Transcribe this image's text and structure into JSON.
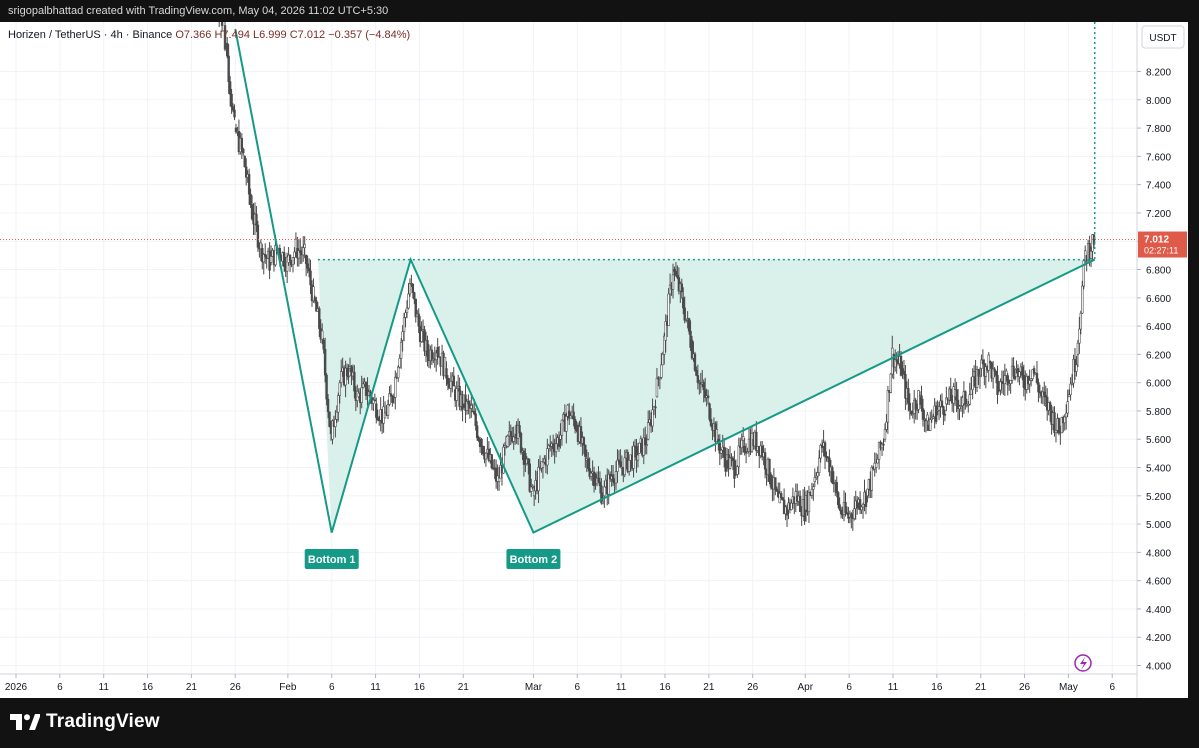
{
  "header": {
    "attribution": "srigopalbhattad created with TradingView.com, May 04, 2026 11:02 UTC+5:30"
  },
  "brand": {
    "name": "TradingView",
    "logo_icon": "tradingview-logo-icon"
  },
  "colors": {
    "accent": "#149a86",
    "fill": "#d4eee8",
    "price_line": "#e05a4a",
    "candle": "#4a4a4a"
  },
  "chart_data": {
    "type": "candlestick",
    "legend": {
      "symbol": "Horizen / TetherUS · 4h · Binance",
      "open": "O7.366",
      "high": "H7.494",
      "low": "L6.999",
      "close": "C7.012",
      "change": "−0.357 (−4.84%)"
    },
    "currency": "USDT",
    "ylim": [
      3.94,
      8.55
    ],
    "y_ticks": [
      "8.200",
      "8.000",
      "7.800",
      "7.600",
      "7.400",
      "7.200",
      "7.000",
      "6.800",
      "6.600",
      "6.400",
      "6.200",
      "6.000",
      "5.800",
      "5.600",
      "5.400",
      "5.200",
      "5.000",
      "4.800",
      "4.600",
      "4.400",
      "4.200",
      "4.000"
    ],
    "x_ticks": [
      {
        "label": "2026",
        "date": "2026-01-01"
      },
      {
        "label": "6",
        "date": "2026-01-06"
      },
      {
        "label": "11",
        "date": "2026-01-11"
      },
      {
        "label": "16",
        "date": "2026-01-16"
      },
      {
        "label": "21",
        "date": "2026-01-21"
      },
      {
        "label": "26",
        "date": "2026-01-26"
      },
      {
        "label": "Feb",
        "date": "2026-02-01"
      },
      {
        "label": "6",
        "date": "2026-02-06"
      },
      {
        "label": "11",
        "date": "2026-02-11"
      },
      {
        "label": "16",
        "date": "2026-02-16"
      },
      {
        "label": "21",
        "date": "2026-02-21"
      },
      {
        "label": "Mar",
        "date": "2026-03-01"
      },
      {
        "label": "6",
        "date": "2026-03-06"
      },
      {
        "label": "11",
        "date": "2026-03-11"
      },
      {
        "label": "16",
        "date": "2026-03-16"
      },
      {
        "label": "21",
        "date": "2026-03-21"
      },
      {
        "label": "26",
        "date": "2026-03-26"
      },
      {
        "label": "Apr",
        "date": "2026-04-01"
      },
      {
        "label": "6",
        "date": "2026-04-06"
      },
      {
        "label": "11",
        "date": "2026-04-11"
      },
      {
        "label": "16",
        "date": "2026-04-16"
      },
      {
        "label": "21",
        "date": "2026-04-21"
      },
      {
        "label": "26",
        "date": "2026-04-26"
      },
      {
        "label": "May",
        "date": "2026-05-01"
      },
      {
        "label": "6",
        "date": "2026-05-06"
      }
    ],
    "current_price": {
      "label": "7.012",
      "value": 7.012,
      "countdown": "02:27:11"
    },
    "price_path": [
      {
        "date": "2026-01-23",
        "price": 9.0
      },
      {
        "date": "2026-01-25",
        "price": 8.4
      },
      {
        "date": "2026-01-26",
        "price": 7.8
      },
      {
        "date": "2026-01-27",
        "price": 7.6
      },
      {
        "date": "2026-01-28",
        "price": 7.2
      },
      {
        "date": "2026-01-29",
        "price": 6.95
      },
      {
        "date": "2026-01-30",
        "price": 6.85
      },
      {
        "date": "2026-01-31",
        "price": 6.95
      },
      {
        "date": "2026-02-01",
        "price": 6.85
      },
      {
        "date": "2026-02-02",
        "price": 6.95
      },
      {
        "date": "2026-02-03",
        "price": 6.9
      },
      {
        "date": "2026-02-04",
        "price": 6.6
      },
      {
        "date": "2026-02-05",
        "price": 6.3
      },
      {
        "date": "2026-02-06",
        "price": 5.6
      },
      {
        "date": "2026-02-07",
        "price": 6.0
      },
      {
        "date": "2026-02-08",
        "price": 6.1
      },
      {
        "date": "2026-02-09",
        "price": 5.9
      },
      {
        "date": "2026-02-10",
        "price": 5.95
      },
      {
        "date": "2026-02-11",
        "price": 5.85
      },
      {
        "date": "2026-02-12",
        "price": 5.75
      },
      {
        "date": "2026-02-13",
        "price": 5.9
      },
      {
        "date": "2026-02-14",
        "price": 6.3
      },
      {
        "date": "2026-02-15",
        "price": 6.7
      },
      {
        "date": "2026-02-16",
        "price": 6.4
      },
      {
        "date": "2026-02-17",
        "price": 6.2
      },
      {
        "date": "2026-02-18",
        "price": 6.25
      },
      {
        "date": "2026-02-19",
        "price": 6.1
      },
      {
        "date": "2026-02-20",
        "price": 5.95
      },
      {
        "date": "2026-02-21",
        "price": 5.85
      },
      {
        "date": "2026-02-22",
        "price": 5.8
      },
      {
        "date": "2026-02-23",
        "price": 5.6
      },
      {
        "date": "2026-02-24",
        "price": 5.45
      },
      {
        "date": "2026-02-25",
        "price": 5.3
      },
      {
        "date": "2026-02-26",
        "price": 5.55
      },
      {
        "date": "2026-02-27",
        "price": 5.7
      },
      {
        "date": "2026-02-28",
        "price": 5.5
      },
      {
        "date": "2026-03-01",
        "price": 5.2
      },
      {
        "date": "2026-03-02",
        "price": 5.4
      },
      {
        "date": "2026-03-03",
        "price": 5.55
      },
      {
        "date": "2026-03-04",
        "price": 5.6
      },
      {
        "date": "2026-03-05",
        "price": 5.8
      },
      {
        "date": "2026-03-06",
        "price": 5.7
      },
      {
        "date": "2026-03-07",
        "price": 5.45
      },
      {
        "date": "2026-03-08",
        "price": 5.35
      },
      {
        "date": "2026-03-09",
        "price": 5.2
      },
      {
        "date": "2026-03-10",
        "price": 5.35
      },
      {
        "date": "2026-03-11",
        "price": 5.4
      },
      {
        "date": "2026-03-12",
        "price": 5.45
      },
      {
        "date": "2026-03-13",
        "price": 5.5
      },
      {
        "date": "2026-03-14",
        "price": 5.6
      },
      {
        "date": "2026-03-15",
        "price": 5.9
      },
      {
        "date": "2026-03-16",
        "price": 6.3
      },
      {
        "date": "2026-03-17",
        "price": 6.8
      },
      {
        "date": "2026-03-18",
        "price": 6.6
      },
      {
        "date": "2026-03-19",
        "price": 6.3
      },
      {
        "date": "2026-03-20",
        "price": 6.0
      },
      {
        "date": "2026-03-21",
        "price": 5.85
      },
      {
        "date": "2026-03-22",
        "price": 5.6
      },
      {
        "date": "2026-03-23",
        "price": 5.45
      },
      {
        "date": "2026-03-24",
        "price": 5.4
      },
      {
        "date": "2026-03-25",
        "price": 5.55
      },
      {
        "date": "2026-03-26",
        "price": 5.6
      },
      {
        "date": "2026-03-27",
        "price": 5.55
      },
      {
        "date": "2026-03-28",
        "price": 5.35
      },
      {
        "date": "2026-03-29",
        "price": 5.15
      },
      {
        "date": "2026-03-30",
        "price": 5.1
      },
      {
        "date": "2026-03-31",
        "price": 5.2
      },
      {
        "date": "2026-04-01",
        "price": 5.1
      },
      {
        "date": "2026-04-02",
        "price": 5.3
      },
      {
        "date": "2026-04-03",
        "price": 5.55
      },
      {
        "date": "2026-04-04",
        "price": 5.4
      },
      {
        "date": "2026-04-05",
        "price": 5.1
      },
      {
        "date": "2026-04-06",
        "price": 5.05
      },
      {
        "date": "2026-04-07",
        "price": 5.15
      },
      {
        "date": "2026-04-08",
        "price": 5.2
      },
      {
        "date": "2026-04-09",
        "price": 5.4
      },
      {
        "date": "2026-04-10",
        "price": 5.6
      },
      {
        "date": "2026-04-11",
        "price": 6.2
      },
      {
        "date": "2026-04-12",
        "price": 6.1
      },
      {
        "date": "2026-04-13",
        "price": 5.8
      },
      {
        "date": "2026-04-14",
        "price": 5.9
      },
      {
        "date": "2026-04-15",
        "price": 5.7
      },
      {
        "date": "2026-04-16",
        "price": 5.8
      },
      {
        "date": "2026-04-17",
        "price": 5.85
      },
      {
        "date": "2026-04-18",
        "price": 5.9
      },
      {
        "date": "2026-04-19",
        "price": 5.85
      },
      {
        "date": "2026-04-20",
        "price": 5.95
      },
      {
        "date": "2026-04-21",
        "price": 6.1
      },
      {
        "date": "2026-04-22",
        "price": 6.15
      },
      {
        "date": "2026-04-23",
        "price": 5.95
      },
      {
        "date": "2026-04-24",
        "price": 6.05
      },
      {
        "date": "2026-04-25",
        "price": 6.1
      },
      {
        "date": "2026-04-26",
        "price": 6.0
      },
      {
        "date": "2026-04-27",
        "price": 6.1
      },
      {
        "date": "2026-04-28",
        "price": 5.9
      },
      {
        "date": "2026-04-29",
        "price": 5.8
      },
      {
        "date": "2026-04-30",
        "price": 5.65
      },
      {
        "date": "2026-05-01",
        "price": 5.9
      },
      {
        "date": "2026-05-02",
        "price": 6.2
      },
      {
        "date": "2026-05-03",
        "price": 6.9
      },
      {
        "date": "2026-05-04",
        "price": 7.012
      }
    ],
    "annotations": {
      "pattern": [
        {
          "date": "2026-01-26",
          "price": 8.5
        },
        {
          "date": "2026-02-06",
          "price": 4.94
        },
        {
          "date": "2026-02-15",
          "price": 6.87
        },
        {
          "date": "2026-02-29",
          "price": 4.94
        },
        {
          "date": "2026-05-04",
          "price": 6.87
        }
      ],
      "neckline": {
        "price": 6.87,
        "from": "2026-02-01",
        "to": "2026-05-04"
      },
      "vertical_line": {
        "date": "2026-05-04"
      },
      "labels": [
        {
          "text": "Bottom 1",
          "date": "2026-02-06"
        },
        {
          "text": "Bottom 2",
          "date": "2026-02-29"
        }
      ]
    }
  }
}
